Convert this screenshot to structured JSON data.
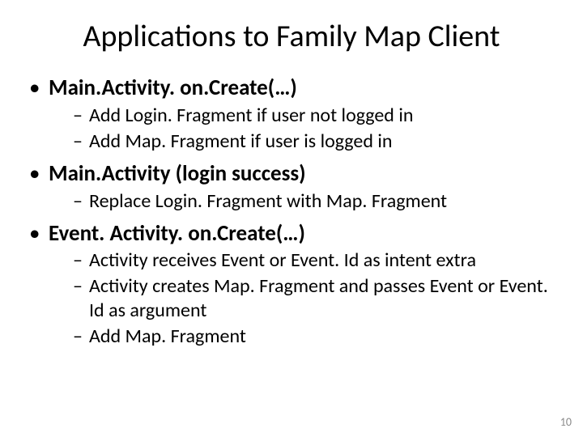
{
  "title": "Applications to Family Map Client",
  "bullets": [
    {
      "label": "Main.Activity. on.Create(…)",
      "sub": [
        "Add Login. Fragment if user not logged in",
        "Add Map. Fragment if user is logged in"
      ]
    },
    {
      "label": "Main.Activity (login success)",
      "sub": [
        "Replace Login. Fragment with Map. Fragment"
      ]
    },
    {
      "label": "Event. Activity. on.Create(…)",
      "sub": [
        "Activity receives Event or Event. Id as intent extra",
        "Activity creates Map. Fragment and passes Event or Event. Id as argument",
        "Add Map. Fragment"
      ]
    }
  ],
  "page_number": "10"
}
